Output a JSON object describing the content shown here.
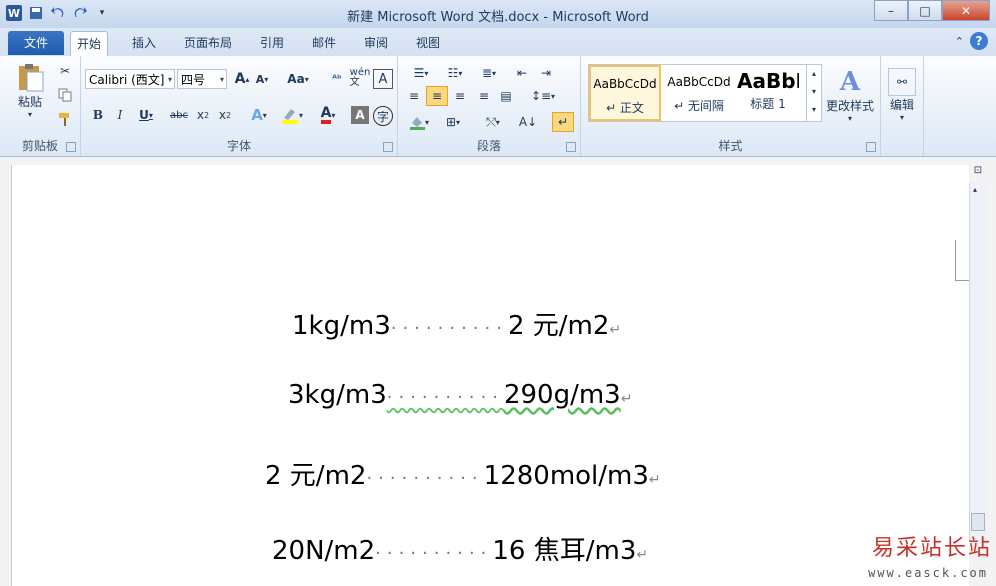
{
  "window": {
    "title": "新建 Microsoft Word 文档.docx - Microsoft Word",
    "controls": {
      "minimize": "–",
      "maximize": "□",
      "close": "✕"
    }
  },
  "tabs": {
    "file": "文件",
    "items": [
      "开始",
      "插入",
      "页面布局",
      "引用",
      "邮件",
      "审阅",
      "视图"
    ]
  },
  "ribbon": {
    "clipboard": {
      "paste": "粘贴",
      "label": "剪贴板"
    },
    "font": {
      "name": "Calibri (西文]",
      "size": "四号",
      "label": "字体",
      "change_case": "Aa",
      "wen": "wén\n文",
      "a_box": "A"
    },
    "paragraph": {
      "label": "段落"
    },
    "styles": {
      "label": "样式",
      "tiles": [
        {
          "preview": "AaBbCcDd",
          "name": "↵ 正文"
        },
        {
          "preview": "AaBbCcDd",
          "name": "↵ 无间隔"
        },
        {
          "preview": "AaBbI",
          "name": "标题 1"
        }
      ],
      "change_styles": "更改样式"
    },
    "editing": {
      "label": "编辑"
    }
  },
  "document": {
    "lines": [
      {
        "left": "1kg/m3",
        "right": "2 元/m2"
      },
      {
        "left": "3kg/m3",
        "right": "290g/m3"
      },
      {
        "left": "2 元/m2",
        "right": "1280mol/m3"
      },
      {
        "left": "20N/m2",
        "right": "16 焦耳/m3"
      }
    ],
    "dots": "··········",
    "paragraph_mark": "↵"
  },
  "watermark": {
    "cn": "易采站长站",
    "url": "www.easck.com"
  }
}
